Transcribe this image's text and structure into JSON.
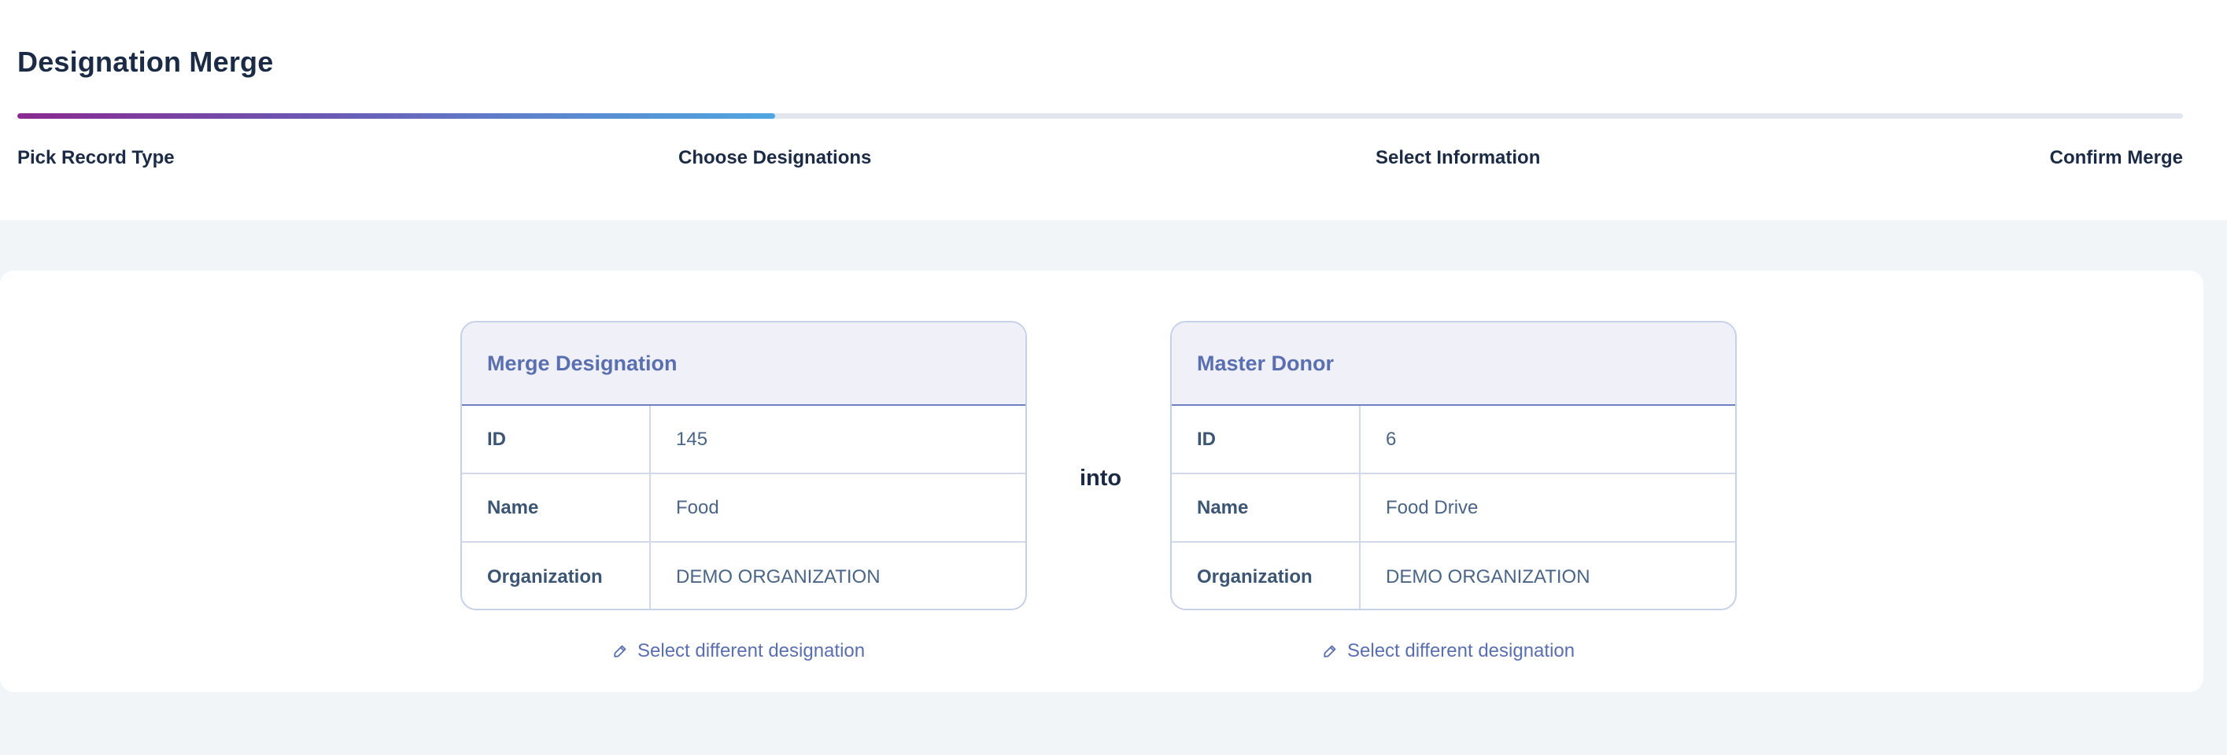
{
  "page": {
    "title": "Designation Merge"
  },
  "progress": {
    "fraction": 0.35,
    "steps": [
      "Pick Record Type",
      "Choose Designations",
      "Select Information",
      "Confirm Merge"
    ]
  },
  "merge_card": {
    "title": "Merge Designation",
    "rows": [
      {
        "label": "ID",
        "value": "145"
      },
      {
        "label": "Name",
        "value": "Food"
      },
      {
        "label": "Organization",
        "value": "DEMO ORGANIZATION"
      }
    ],
    "link_label": "Select different designation",
    "link_icon": "pencil-icon"
  },
  "connector": {
    "label": "into"
  },
  "master_card": {
    "title": "Master Donor",
    "rows": [
      {
        "label": "ID",
        "value": "6"
      },
      {
        "label": "Name",
        "value": "Food Drive"
      },
      {
        "label": "Organization",
        "value": "DEMO ORGANIZATION"
      }
    ],
    "link_label": "Select different designation",
    "link_icon": "pencil-icon"
  },
  "colors": {
    "accent": "#5a6fb0",
    "progress_start": "#8a2a8f",
    "progress_end": "#4fa6e0",
    "card_header_bg": "#eff0f8"
  }
}
